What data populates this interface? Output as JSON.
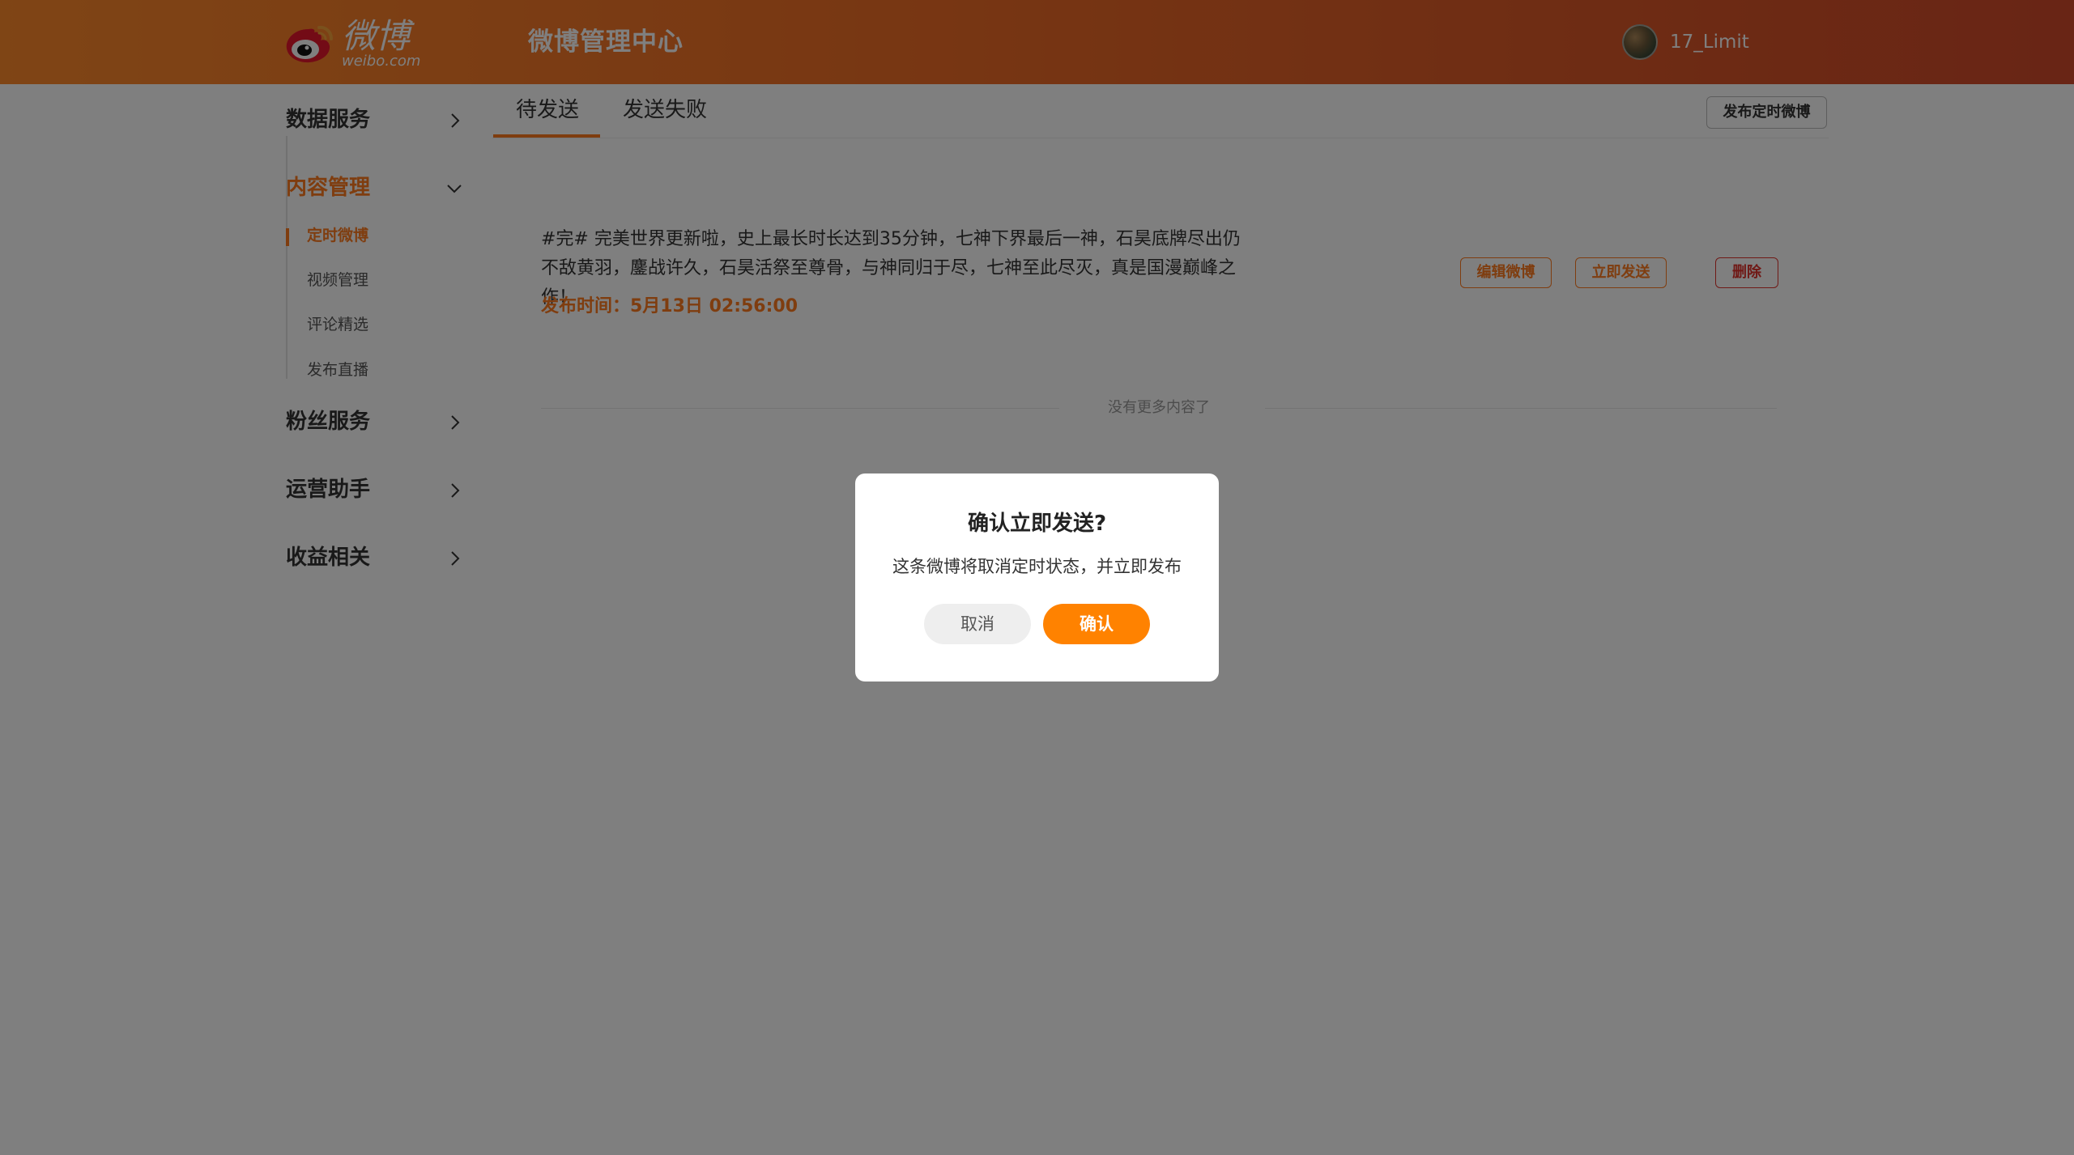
{
  "header": {
    "logo_text": "微博",
    "logo_sub": "weibo.com",
    "title": "微博管理中心",
    "username": "17_Limit"
  },
  "sidebar": {
    "groups": [
      {
        "label": "数据服务",
        "icon": "chevron-right-icon"
      },
      {
        "label": "内容管理",
        "icon": "chevron-down-icon",
        "active": true
      },
      {
        "label": "粉丝服务",
        "icon": "chevron-right-icon"
      },
      {
        "label": "运营助手",
        "icon": "chevron-right-icon"
      },
      {
        "label": "收益相关",
        "icon": "chevron-right-icon"
      }
    ],
    "sub_items": [
      {
        "label": "定时微博",
        "active": true
      },
      {
        "label": "视频管理"
      },
      {
        "label": "评论精选"
      },
      {
        "label": "发布直播"
      }
    ]
  },
  "main": {
    "tabs": [
      {
        "label": "待发送",
        "active": true
      },
      {
        "label": "发送失败"
      }
    ],
    "publish_button": "发布定时微博",
    "post": {
      "text": "#完# 完美世界更新啦，史上最长时长达到35分钟，七神下界最后一神，石昊底牌尽出仍不敌黄羽，鏖战许久，石昊活祭至尊骨，与神同归于尽，七神至此尽灭，真是国漫巅峰之作！",
      "time_label": "发布时间：5月13日 02:56:00",
      "edit_button": "编辑微博",
      "send_now_button": "立即发送",
      "delete_button": "删除"
    },
    "no_more": "没有更多内容了"
  },
  "dialog": {
    "title": "确认立即发送?",
    "message": "这条微博将取消定时状态，并立即发布",
    "cancel": "取消",
    "confirm": "确认"
  },
  "colors": {
    "accent": "#ff7a1e",
    "confirm": "#ff8200",
    "danger": "#e0332c",
    "overlay": "rgba(0,0,0,0.5)"
  }
}
